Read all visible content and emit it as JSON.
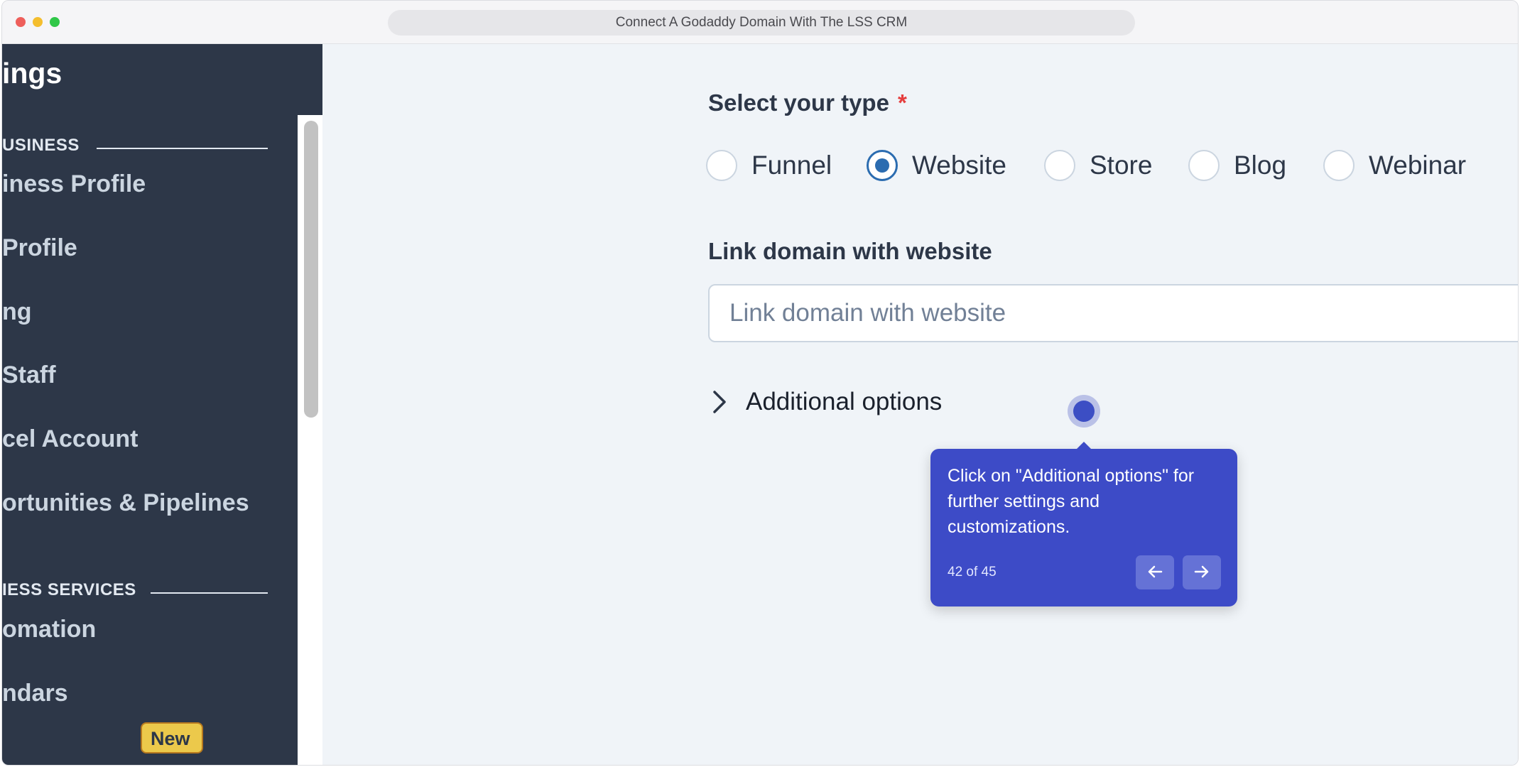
{
  "window": {
    "title": "Connect A Godaddy Domain With The LSS CRM"
  },
  "sidebar": {
    "title": "ings",
    "sections": [
      {
        "heading": "USINESS"
      },
      {
        "heading": "IESS SERVICES"
      }
    ],
    "items": [
      {
        "label": "iness Profile"
      },
      {
        "label": "Profile"
      },
      {
        "label": "ng"
      },
      {
        "label": "Staff"
      },
      {
        "label": "cel Account"
      },
      {
        "label": "ortunities & Pipelines"
      },
      {
        "label": "omation"
      },
      {
        "label": "ndars"
      }
    ],
    "new_badge": "New"
  },
  "form": {
    "type_label": "Select your type",
    "required_mark": "*",
    "type_options": [
      {
        "label": "Funnel",
        "selected": false
      },
      {
        "label": "Website",
        "selected": true
      },
      {
        "label": "Store",
        "selected": false
      },
      {
        "label": "Blog",
        "selected": false
      },
      {
        "label": "Webinar",
        "selected": false
      }
    ],
    "link_label": "Link domain with website",
    "link_placeholder": "Link domain with website",
    "link_value": "",
    "additional_options": "Additional options"
  },
  "tooltip": {
    "text": "Click on \"Additional options\" for further settings and customizations.",
    "step": "42 of 45",
    "prev_icon": "arrow-left-icon",
    "next_icon": "arrow-right-icon"
  },
  "colors": {
    "sidebar_bg": "#2d3748",
    "radio_accent": "#2b6cb0",
    "tooltip_bg": "#3d4bc7",
    "required": "#e53e3e",
    "badge": "#ecc94b"
  }
}
